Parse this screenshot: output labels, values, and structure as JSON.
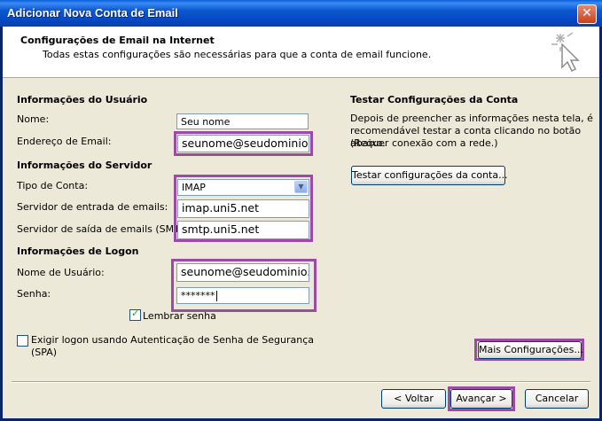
{
  "window": {
    "title": "Adicionar Nova Conta de Email",
    "close_symbol": "✕"
  },
  "header": {
    "title": "Configurações de Email na Internet",
    "subtitle": "Todas estas configurações são necessárias para que a conta de email funcione."
  },
  "user_info": {
    "heading": "Informações do Usuário",
    "name_label": "Nome:",
    "name_value": "Seu nome",
    "email_label": "Endereço de Email:",
    "email_value": "seunome@seudominio."
  },
  "server_info": {
    "heading": "Informações do Servidor",
    "account_type_label": "Tipo de Conta:",
    "account_type_value": "IMAP",
    "incoming_label": "Servidor de entrada de emails:",
    "incoming_value": "imap.uni5.net",
    "outgoing_label": "Servidor de saída de emails (SMTP):",
    "outgoing_value": "smtp.uni5.net"
  },
  "logon_info": {
    "heading": "Informações de Logon",
    "username_label": "Nome de Usuário:",
    "username_value": "seunome@seudominio.",
    "password_label": "Senha:",
    "password_value": "*******",
    "remember_label": "Lembrar senha",
    "remember_checked": true,
    "spa_label_line1": "Exigir logon usando Autenticação de Senha de Segurança",
    "spa_label_line2": "(SPA)",
    "spa_checked": false
  },
  "test_panel": {
    "heading": "Testar Configurações da Conta",
    "description_line1": "Depois de preencher as informações nesta tela, é",
    "description_line2": "recomendável testar a conta clicando no botão abaixo.",
    "description_line3": "(Requer conexão com a rede.)",
    "test_button": "Testar configurações da conta...",
    "more_settings_button": "Mais Configurações..."
  },
  "footer": {
    "back_button": "< Voltar",
    "next_button": "Avançar >",
    "cancel_button": "Cancelar"
  },
  "colors": {
    "highlight": "#9b4aa5",
    "titlebar": "#0b57d0",
    "dialog_bg": "#ece9d8"
  }
}
